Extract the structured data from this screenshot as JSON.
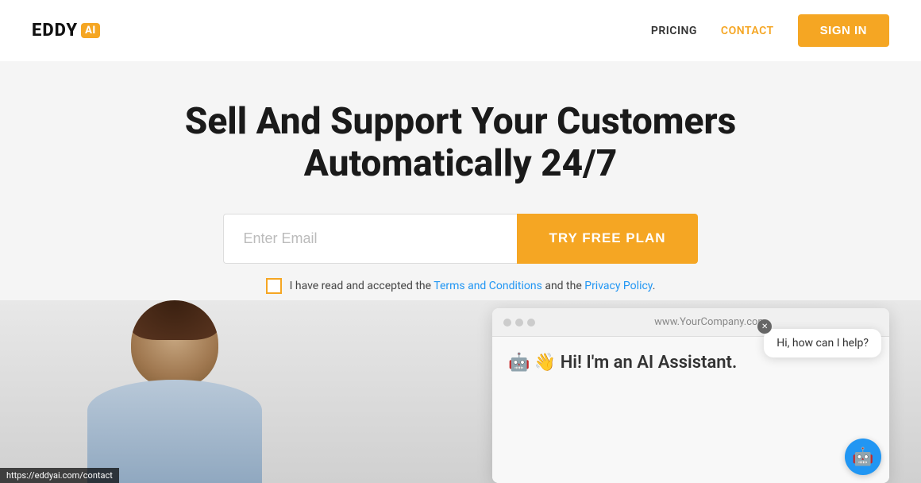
{
  "header": {
    "logo_text": "EDDY",
    "logo_badge": "AI",
    "nav": {
      "pricing_label": "PRICING",
      "contact_label": "CONTACT",
      "signin_label": "SIGN IN"
    }
  },
  "hero": {
    "title_line1": "Sell And Support Your Customers",
    "title_line2": "Automatically 24/7",
    "email_placeholder": "Enter Email",
    "try_btn_label": "TRY FREE PLAN",
    "checkbox_text_before": "I have read and accepted the ",
    "checkbox_terms_label": "Terms and Conditions",
    "checkbox_text_mid": " and the ",
    "checkbox_privacy_label": "Privacy Policy",
    "checkbox_text_after": "."
  },
  "browser_mockup": {
    "url": "www.YourCompany.com",
    "ai_greeting": "🤖 👋 Hi! I'm an AI Assistant.",
    "chat_bubble": "Hi, how can I help?"
  },
  "footer": {
    "url_hint": "https://eddyai.com/contact"
  }
}
